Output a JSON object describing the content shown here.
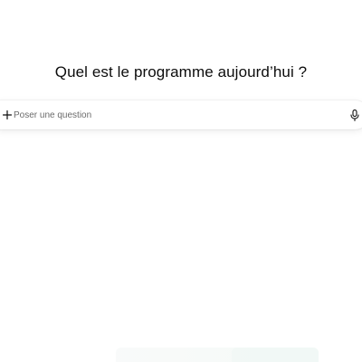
{
  "headline": "Quel est le programme aujourd’hui ?",
  "composer": {
    "placeholder": "Poser une question",
    "value": "",
    "add_icon": "plus-icon",
    "voice_icon": "microphone-icon"
  }
}
